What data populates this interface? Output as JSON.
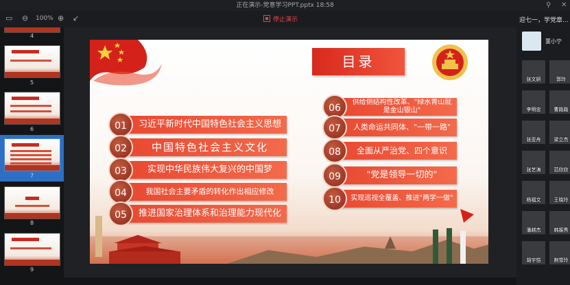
{
  "window": {
    "title": "正在演示-党意学习PPT.pptx 18:58"
  },
  "toolbar": {
    "zoom": "100%",
    "stop_label": "停止演示"
  },
  "thumbnails": [
    {
      "num": "4"
    },
    {
      "num": "5"
    },
    {
      "num": "6"
    },
    {
      "num": "7",
      "selected": true
    },
    {
      "num": "8"
    },
    {
      "num": "9"
    }
  ],
  "slide": {
    "heading": "目录",
    "items": [
      {
        "num": "01",
        "text": "习近平新时代中国特色社会主义思想"
      },
      {
        "num": "02",
        "text": "中国特色社会主义文化"
      },
      {
        "num": "03",
        "text": "实现中华民族伟大复兴的中国梦"
      },
      {
        "num": "04",
        "text": "我国社会主要矛盾的转化作出相应修改"
      },
      {
        "num": "05",
        "text": "推进国家治理体系和治理能力现代化"
      },
      {
        "num": "06",
        "text": "供给侧结构性改革、\"绿水青山就是金山银山\""
      },
      {
        "num": "07",
        "text": "人类命运共同体、\"一带一路\""
      },
      {
        "num": "08",
        "text": "全面从严治党、四个意识"
      },
      {
        "num": "09",
        "text": "\"党是领导一切的\""
      },
      {
        "num": "10",
        "text": "实现巡视全覆盖、推进\"两学一做\""
      }
    ]
  },
  "participants_panel": {
    "title": "迎七一，学党章...",
    "host": "董小宁",
    "attendees": [
      "张文妍",
      "郭玲",
      "李明忠",
      "曹路路",
      "张亚舟",
      "梁立杰",
      "张艺涛",
      "范欣欣",
      "杨福文",
      "王晓玲",
      "潘越杰",
      "韩振秀",
      "胡宇恺",
      "荆雪玲"
    ]
  }
}
